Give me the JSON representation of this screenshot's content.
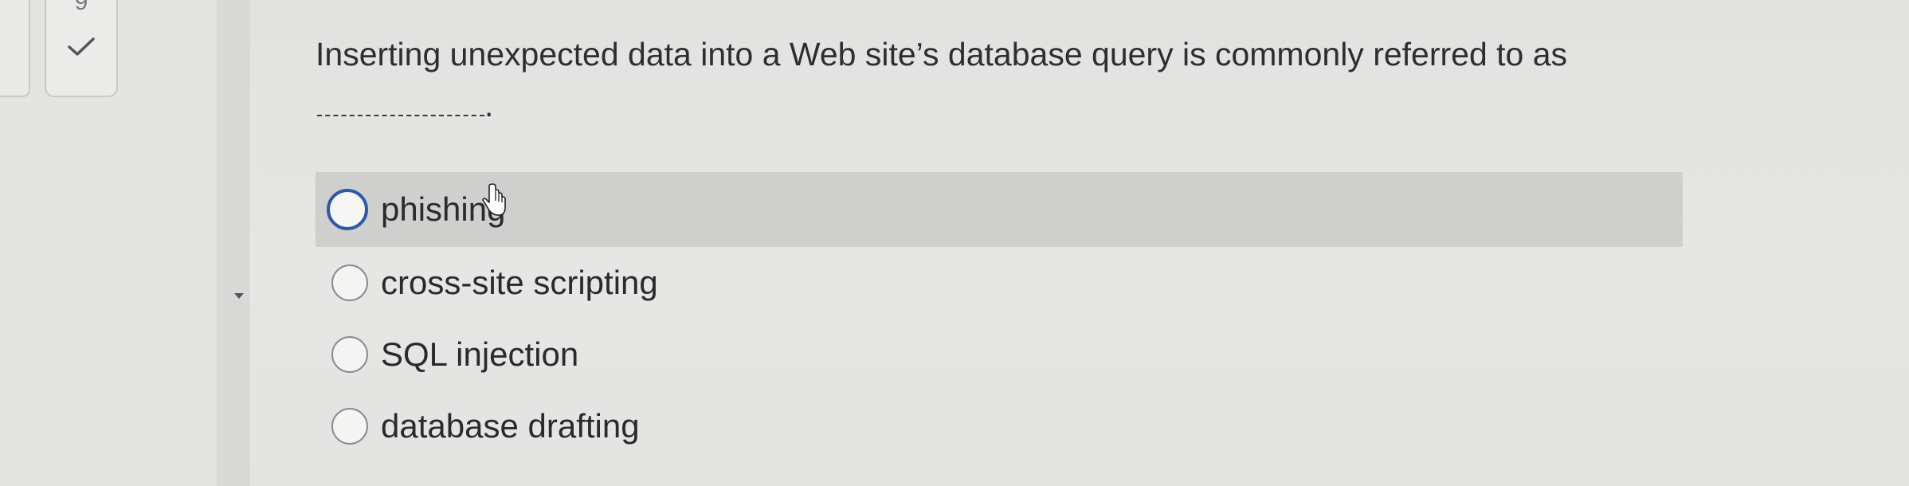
{
  "nav": {
    "question_number": "9",
    "status_icon": "check-icon"
  },
  "question": {
    "text": "Inserting unexpected data into a Web site’s database query is commonly referred to as",
    "end_punctuation": "."
  },
  "options": [
    {
      "label": "phishing",
      "hovered": true
    },
    {
      "label": "cross-site scripting",
      "hovered": false
    },
    {
      "label": "SQL injection",
      "hovered": false
    },
    {
      "label": "database drafting",
      "hovered": false
    }
  ],
  "colors": {
    "radio_hover_border": "#2b5aa8",
    "hover_row_bg": "#cfcfcd",
    "page_bg": "#e4e4e2"
  }
}
